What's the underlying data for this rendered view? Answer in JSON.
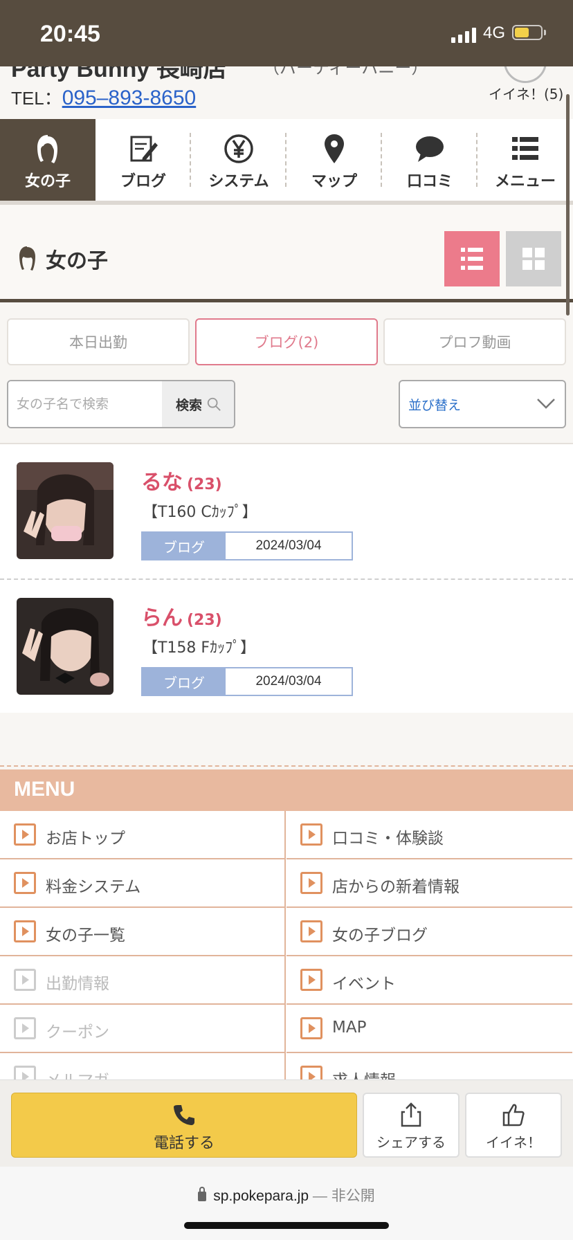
{
  "status_bar": {
    "time": "20:45",
    "network": "4G"
  },
  "shop": {
    "name": "Party Bunny 長崎店",
    "kana": "（パーティーバニー）",
    "tel_label": "TEL：",
    "tel_number": "095–893-8650",
    "like_count_label": "イイネ！(5)"
  },
  "nav": {
    "items": [
      {
        "label": "女の子",
        "icon": "girl-icon"
      },
      {
        "label": "ブログ",
        "icon": "blog-icon"
      },
      {
        "label": "システム",
        "icon": "yen-icon"
      },
      {
        "label": "マップ",
        "icon": "map-pin-icon"
      },
      {
        "label": "口コミ",
        "icon": "speech-bubble-icon"
      },
      {
        "label": "メニュー",
        "icon": "menu-list-icon"
      }
    ]
  },
  "section": {
    "title": "女の子"
  },
  "tabs": [
    {
      "label": "本日出勤"
    },
    {
      "label": "ブログ(2)"
    },
    {
      "label": "プロフ動画"
    }
  ],
  "search": {
    "placeholder": "女の子名で検索",
    "button_label": "検索"
  },
  "sort": {
    "label": "並び替え"
  },
  "girls": [
    {
      "name": "るな",
      "age": "(23)",
      "spec": "【T160 Cｶｯﾌﾟ】",
      "blog_tag": "ブログ",
      "date": "2024/03/04"
    },
    {
      "name": "らん",
      "age": "(23)",
      "spec": "【T158 Fｶｯﾌﾟ】",
      "blog_tag": "ブログ",
      "date": "2024/03/04"
    }
  ],
  "menu": {
    "title": "MENU",
    "items": [
      {
        "label": "お店トップ",
        "enabled": true
      },
      {
        "label": "口コミ・体験談",
        "enabled": true
      },
      {
        "label": "料金システム",
        "enabled": true
      },
      {
        "label": "店からの新着情報",
        "enabled": true
      },
      {
        "label": "女の子一覧",
        "enabled": true
      },
      {
        "label": "女の子ブログ",
        "enabled": true
      },
      {
        "label": "出勤情報",
        "enabled": false
      },
      {
        "label": "イベント",
        "enabled": true
      },
      {
        "label": "クーポン",
        "enabled": false
      },
      {
        "label": "MAP",
        "enabled": true
      },
      {
        "label": "メルマガ",
        "enabled": false
      },
      {
        "label": "求人情報",
        "enabled": true
      }
    ]
  },
  "actions": {
    "call_label": "電話する",
    "share_label": "シェアする",
    "like_label": "イイネ！"
  },
  "browser": {
    "url": "sp.pokepara.jp",
    "separator": "—",
    "privacy": "非公開"
  },
  "colors": {
    "header_brown": "#574c3f",
    "accent_pink": "#d9506a",
    "list_view_pink": "#ec7b8b",
    "blog_blue": "#9db3da",
    "menu_orange": "#e8b99f",
    "call_yellow": "#f3ca4a",
    "link_blue": "#2a62c9"
  }
}
